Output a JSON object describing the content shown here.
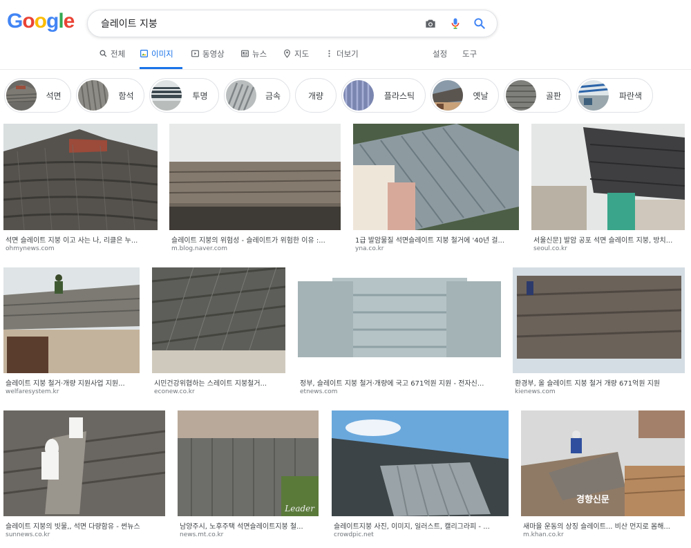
{
  "colors": {
    "blue": "#4285F4",
    "red": "#EA4335",
    "yellow": "#FBBC05",
    "green": "#34A853",
    "tab_active": "#1a73e8"
  },
  "logo": "Google",
  "search": {
    "query": "슬레이트 지붕",
    "icons": [
      "camera-icon",
      "microphone-icon",
      "search-icon"
    ]
  },
  "tabs": [
    {
      "label": "전체",
      "icon": "search-icon",
      "active": false
    },
    {
      "label": "이미지",
      "icon": "image-icon",
      "active": true
    },
    {
      "label": "동영상",
      "icon": "video-icon",
      "active": false
    },
    {
      "label": "뉴스",
      "icon": "news-icon",
      "active": false
    },
    {
      "label": "지도",
      "icon": "map-pin-icon",
      "active": false
    },
    {
      "label": "더보기",
      "icon": "more-icon",
      "active": false
    }
  ],
  "tools": {
    "settings": "설정",
    "tools": "도구"
  },
  "chips": [
    {
      "label": "석면"
    },
    {
      "label": "함석"
    },
    {
      "label": "투명"
    },
    {
      "label": "금속"
    },
    {
      "label": "개량"
    },
    {
      "label": "플라스틱"
    },
    {
      "label": "옛날"
    },
    {
      "label": "골판"
    },
    {
      "label": "파란색"
    }
  ],
  "results": [
    {
      "title": "석면 슬레이트 지붕 이고 사는 나, 리클은 누...",
      "source": "ohmynews.com"
    },
    {
      "title": "슬레이트 지붕의 위험성 - 슬레이트가 위험한 이유 :...",
      "source": "m.blog.naver.com"
    },
    {
      "title": "1급 발암물질 석면슬레이트 지붕 철거에 '40년 걸...",
      "source": "yna.co.kr"
    },
    {
      "title": "서울신문] 발암 공포 석면 슬레이트 지붕, 방치...",
      "source": "seoul.co.kr"
    },
    {
      "title": "슬레이트 지붕 철거·개량 지원사업 지원...",
      "source": "welfaresystem.kr"
    },
    {
      "title": "시민건강위협하는 스레이트 지붕철거...",
      "source": "econew.co.kr"
    },
    {
      "title": "정부, 슬레이트 지붕 철거·개량에 국고 671억원 지원 - 전자신...",
      "source": "etnews.com"
    },
    {
      "title": "환경부, 올 슬레이트 지붕 철거 개량 671억원 지원",
      "source": "kienews.com"
    },
    {
      "title": "슬레이트 지붕의 빗물,, 석면 다량함유 - 썬뉴스",
      "source": "sunnews.co.kr"
    },
    {
      "title": "남양주시, 노후주택 석면슬레이트지붕 철...",
      "source": "news.mt.co.kr"
    },
    {
      "title": "슬레이트지붕 사진, 이미지, 일러스트, 캘리그라피 - ...",
      "source": "crowdpic.net"
    },
    {
      "title": "새마을 운동의 상징 슬레이트... 비산 먼지로 몸해...",
      "source": "m.khan.co.kr"
    }
  ],
  "watermarks": {
    "w9": "Leader",
    "w11": "경향신문"
  }
}
